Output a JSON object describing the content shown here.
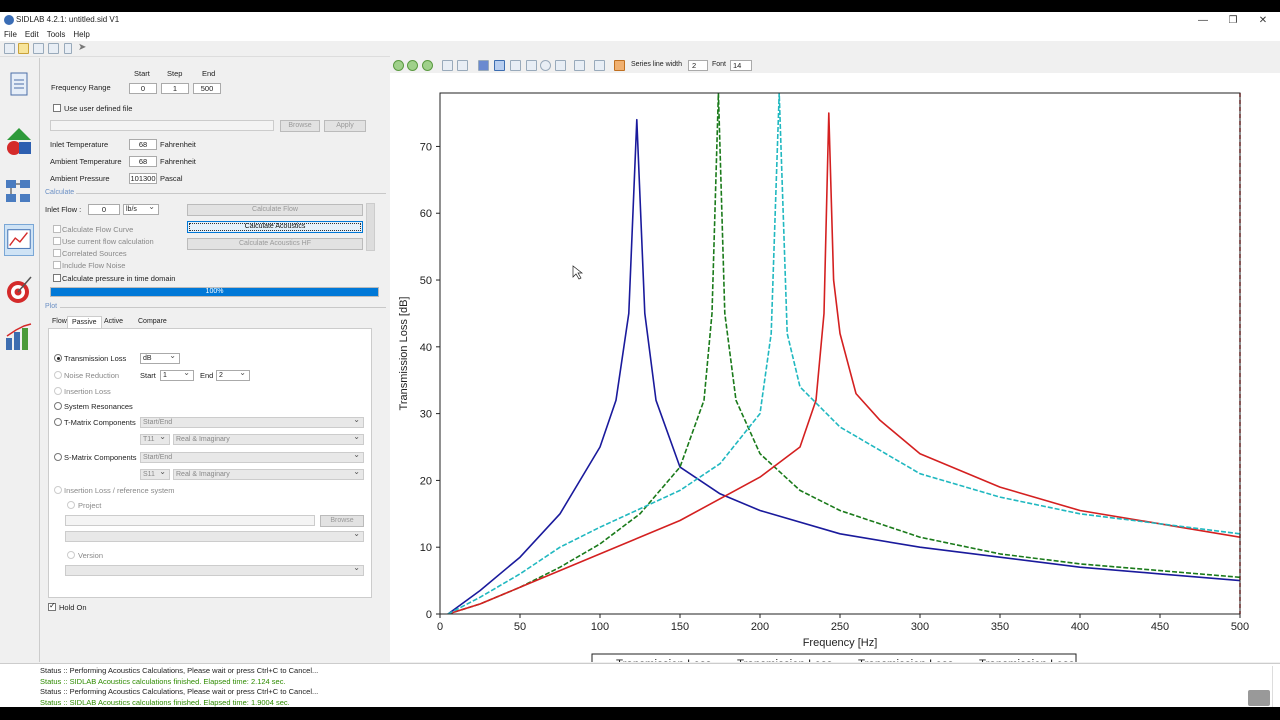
{
  "window": {
    "title": "SIDLAB 4.2.1: untitled.sid V1"
  },
  "menu": [
    "File",
    "Edit",
    "Tools",
    "Help"
  ],
  "freq": {
    "label": "Frequency Range",
    "start_label": "Start",
    "step_label": "Step",
    "end_label": "End",
    "start": "0",
    "step": "1",
    "end": "500"
  },
  "userfile": {
    "label": "Use user defined file",
    "browse": "Browse",
    "apply": "Apply"
  },
  "inlet_temp": {
    "label": "Inlet Temperature",
    "value": "68",
    "unit": "Fahrenheit"
  },
  "ambient_temp": {
    "label": "Ambient Temperature",
    "value": "68",
    "unit": "Fahrenheit"
  },
  "ambient_pressure": {
    "label": "Ambient Pressure",
    "value": "101300",
    "unit": "Pascal"
  },
  "calculate": {
    "section": "Calculate",
    "inlet_flow_label": "Inlet Flow :",
    "inlet_flow_value": "0",
    "inlet_flow_unit": "lb/s",
    "calc_flow": "Calculate Flow",
    "calc_acoustics": "Calculate Acoustics",
    "calc_acoustics_hf": "Calculate Acoustics HF",
    "opt_flow_curve": "Calculate Flow Curve",
    "opt_current_flow": "Use current flow calculation",
    "opt_correlated": "Correlated Sources",
    "opt_flow_noise": "Include Flow Noise",
    "opt_time_domain": "Calculate pressure in time domain",
    "progress": "100%",
    "progress_value": 1.0
  },
  "plot": {
    "section": "Plot",
    "tabs": [
      "Flow",
      "Passive",
      "Active",
      "Compare"
    ],
    "transmission_loss": "Transmission Loss",
    "tl_unit": "dB",
    "noise_reduction": "Noise Reduction",
    "start_label": "Start",
    "start_value": "1",
    "end_label": "End",
    "end_value": "2",
    "insertion_loss": "Insertion Loss",
    "system_resonances": "System Resonances",
    "t_matrix": "T-Matrix Components",
    "t_sel": "Start/End",
    "t11": "T11",
    "t_real": "Real & Imaginary",
    "s_matrix": "S-Matrix Components",
    "s_sel": "Start/End",
    "s11": "S11",
    "s_real": "Real & Imaginary",
    "il_ref": "Insertion Loss / reference system",
    "project": "Project",
    "browse": "Browse",
    "version": "Version",
    "hold_on": "Hold On"
  },
  "plot_toolbar": {
    "series_line_width_label": "Series line width",
    "series_line_width": "2",
    "font_label": "Font",
    "font": "14"
  },
  "status": [
    {
      "text": "Status :: Performing Acoustics Calculations, Please wait or press Ctrl+C to Cancel...",
      "color": "#222222"
    },
    {
      "text": "Status :: SIDLAB Acoustics calculations finished. Elapsed time: 2.124 sec.",
      "color": "#2e8b00"
    },
    {
      "text": "Status :: Performing Acoustics Calculations, Please wait or press Ctrl+C to Cancel...",
      "color": "#222222"
    },
    {
      "text": "Status :: SIDLAB Acoustics calculations finished. Elapsed time: 1.9004 sec.",
      "color": "#2e8b00"
    }
  ],
  "chart_data": {
    "type": "line",
    "xlabel": "Frequency [Hz]",
    "ylabel": "Transmission Loss [dB]",
    "xlim": [
      0,
      500
    ],
    "ylim": [
      0,
      78
    ],
    "xticks": [
      0,
      50,
      100,
      150,
      200,
      250,
      300,
      350,
      400,
      450,
      500
    ],
    "yticks": [
      0,
      10,
      20,
      30,
      40,
      50,
      60,
      70
    ],
    "legend_position": "bottom",
    "series": [
      {
        "name": "Transmission Loss",
        "color": "#1a1a9c",
        "dash": "solid",
        "resonance_hz": 123,
        "peak_db": 74,
        "points": [
          [
            5,
            0
          ],
          [
            25,
            3.5
          ],
          [
            50,
            8.5
          ],
          [
            75,
            15
          ],
          [
            100,
            25
          ],
          [
            110,
            32
          ],
          [
            118,
            45
          ],
          [
            123,
            74
          ],
          [
            128,
            45
          ],
          [
            135,
            32
          ],
          [
            150,
            22
          ],
          [
            175,
            18
          ],
          [
            200,
            15.5
          ],
          [
            250,
            12
          ],
          [
            300,
            10
          ],
          [
            350,
            8.5
          ],
          [
            400,
            7
          ],
          [
            450,
            6
          ],
          [
            500,
            5
          ]
        ]
      },
      {
        "name": "Transmission Loss",
        "color": "#1a7a1a",
        "dash": "dashed",
        "resonance_hz": 174,
        "peak_db": 78,
        "points": [
          [
            5,
            0
          ],
          [
            25,
            1.5
          ],
          [
            50,
            4
          ],
          [
            75,
            7
          ],
          [
            100,
            10.5
          ],
          [
            125,
            15
          ],
          [
            150,
            22
          ],
          [
            165,
            32
          ],
          [
            170,
            45
          ],
          [
            174,
            78
          ],
          [
            178,
            45
          ],
          [
            185,
            32
          ],
          [
            200,
            24
          ],
          [
            225,
            18.5
          ],
          [
            250,
            15.5
          ],
          [
            300,
            11.5
          ],
          [
            350,
            9
          ],
          [
            400,
            7.5
          ],
          [
            450,
            6.5
          ],
          [
            500,
            5.5
          ]
        ]
      },
      {
        "name": "Transmission Loss",
        "color": "#d42020",
        "dash": "solid",
        "resonance_hz": 243,
        "peak_db": 75,
        "points": [
          [
            5,
            0
          ],
          [
            25,
            1.5
          ],
          [
            50,
            4
          ],
          [
            100,
            9
          ],
          [
            150,
            14
          ],
          [
            200,
            20.5
          ],
          [
            225,
            25
          ],
          [
            235,
            32
          ],
          [
            240,
            45
          ],
          [
            243,
            75
          ],
          [
            246,
            50
          ],
          [
            250,
            42
          ],
          [
            260,
            33
          ],
          [
            275,
            29
          ],
          [
            300,
            24
          ],
          [
            350,
            19
          ],
          [
            400,
            15.5
          ],
          [
            450,
            13.5
          ],
          [
            500,
            11.5
          ]
        ]
      },
      {
        "name": "Transmission Loss",
        "color": "#20b8c0",
        "dash": "dashed",
        "resonance_hz": 212,
        "peak_db": 78,
        "points": [
          [
            5,
            0
          ],
          [
            25,
            2.5
          ],
          [
            50,
            6
          ],
          [
            75,
            10
          ],
          [
            100,
            13
          ],
          [
            150,
            18.5
          ],
          [
            175,
            22.5
          ],
          [
            200,
            30
          ],
          [
            207,
            42
          ],
          [
            212,
            78
          ],
          [
            217,
            42
          ],
          [
            225,
            34
          ],
          [
            250,
            28
          ],
          [
            300,
            21
          ],
          [
            350,
            17.5
          ],
          [
            400,
            15
          ],
          [
            450,
            13.5
          ],
          [
            500,
            12
          ]
        ]
      }
    ],
    "marker_line": {
      "x": 500,
      "color": "#d42020",
      "dash": "dashed"
    }
  }
}
